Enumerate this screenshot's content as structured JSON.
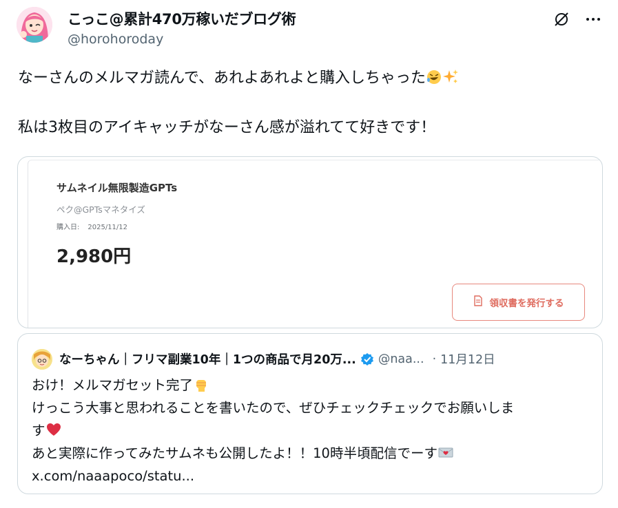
{
  "author": {
    "display_name": "こっこ@累計470万稼いだブログ術",
    "handle": "@horohoroday"
  },
  "top_actions": {
    "grok_icon": "grok-slash-icon",
    "more_icon": "more-horizontal-icon",
    "more_label": "···"
  },
  "tweet": {
    "line1": "なーさんのメルマガ読んで、あれよあれよと購入しちゃった",
    "line1_emojis": [
      "rolling-laughing-emoji",
      "sparkles-emoji"
    ],
    "line2": "私は3枚目のアイキャッチがなーさん感が溢れてて好きです！"
  },
  "media": {
    "product_title": "サムネイル無限製造GPTs",
    "seller": "ペク@GPTsマネタイズ",
    "purchase_label": "購入日:",
    "purchase_date": "2025/11/12",
    "price": "2,980円",
    "receipt_button": "領収書を発行する",
    "accent_color": "#df6c5f"
  },
  "quote": {
    "display_name": "なーちゃん｜フリマ副業10年｜1つの商品で月20万...",
    "handle": "@naa...",
    "dot": "·",
    "time": "11月12日",
    "verified_color": "#1d9bf0",
    "line1": "おけ！メルマガセット完了",
    "line2": "けっこう大事と思われることを書いたので、ぜひチェックチェックでお願いしま",
    "line3": "す",
    "line4": "あと実際に作ってみたサムネも公開したよ！！10時半頃配信でーす",
    "line5": "x.com/naaapoco/statu..."
  }
}
